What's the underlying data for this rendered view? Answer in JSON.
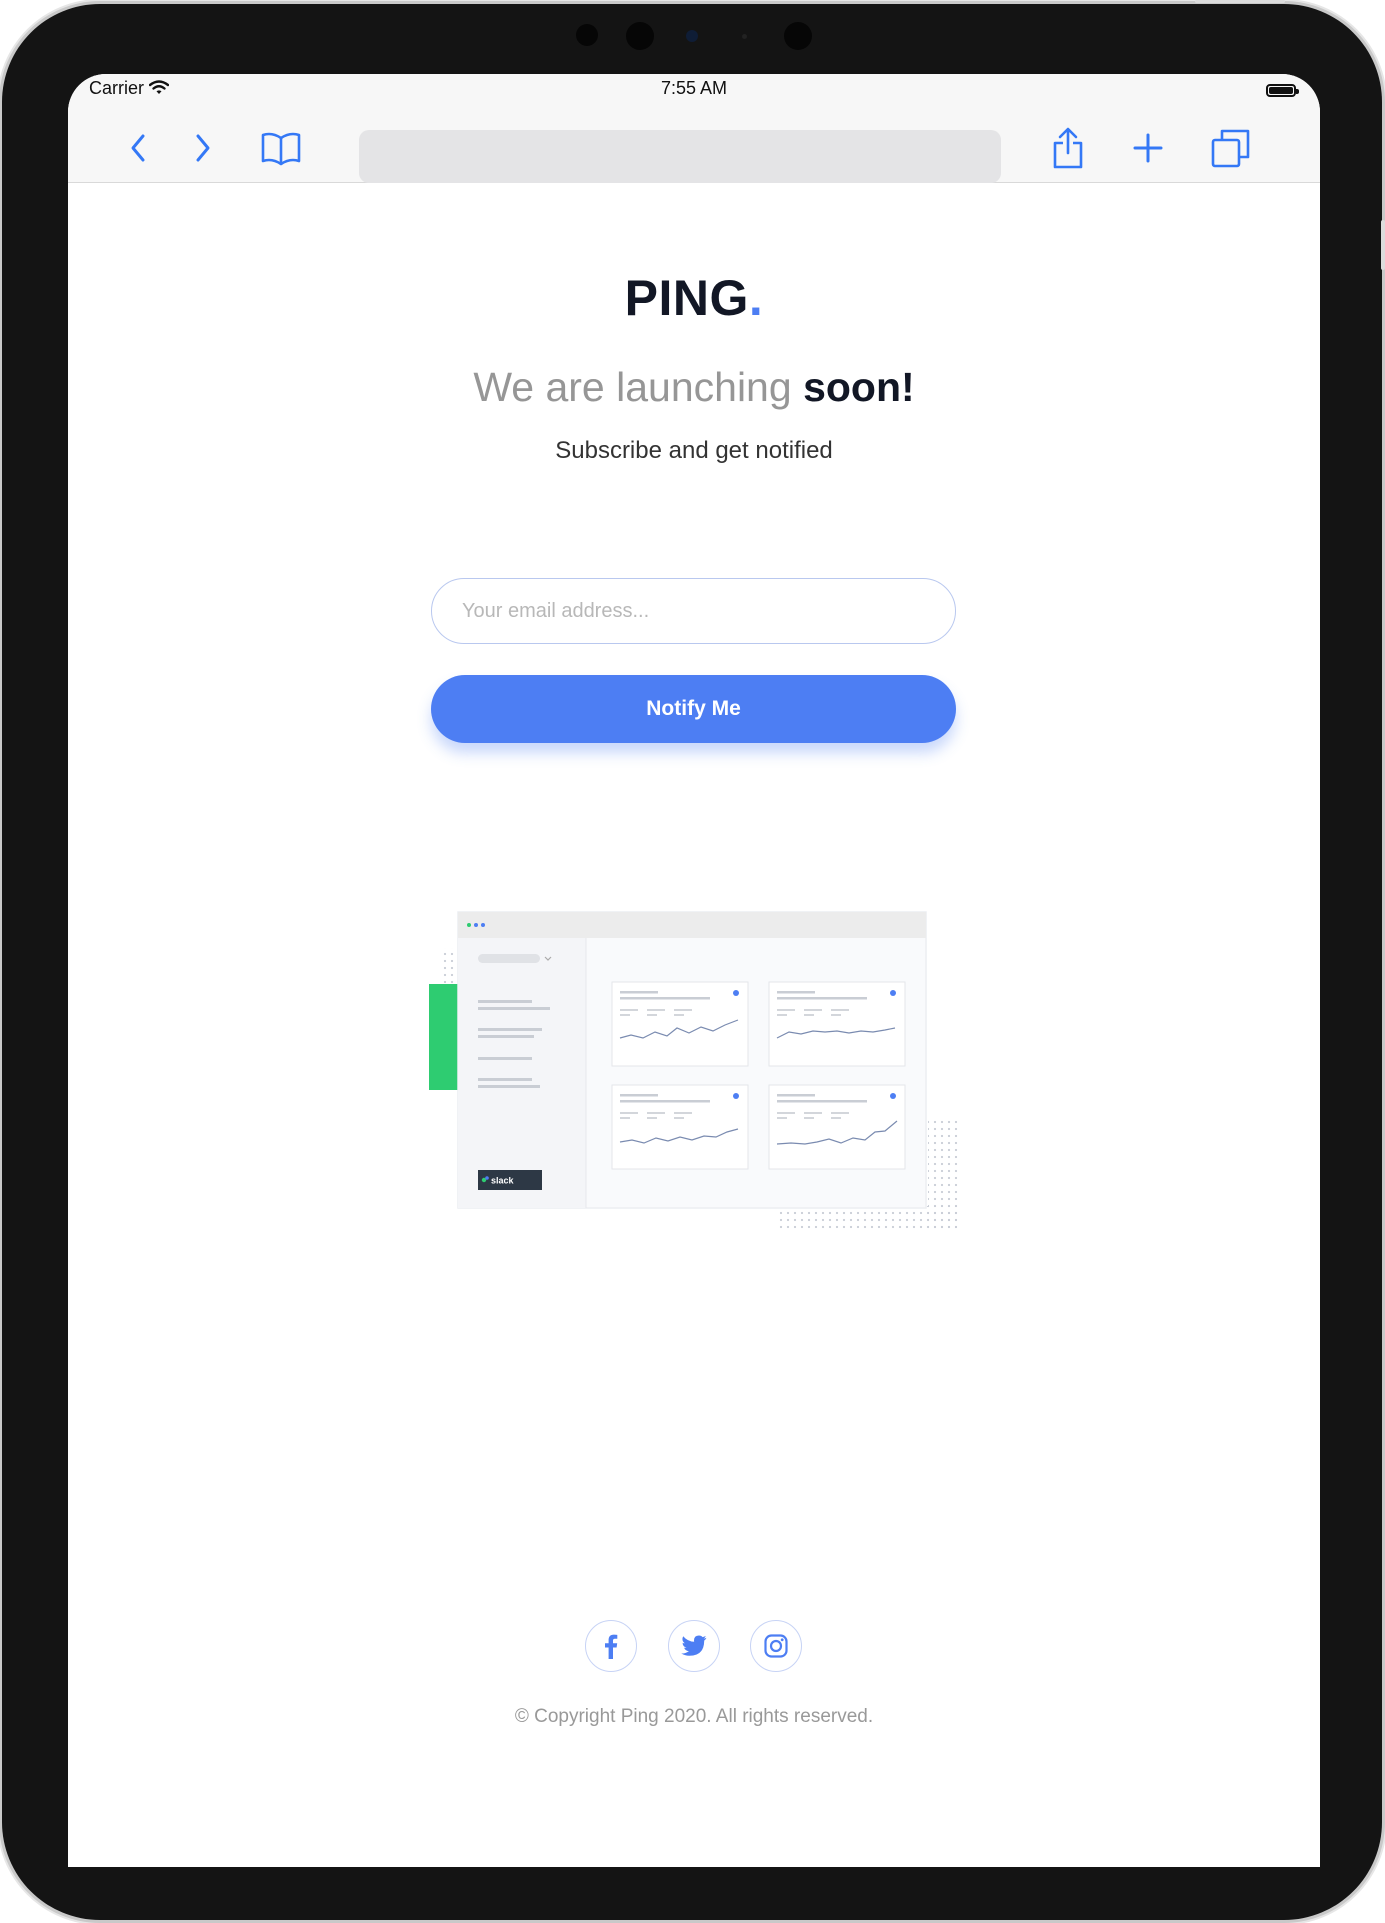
{
  "device": {
    "status_bar": {
      "carrier": "Carrier",
      "time": "7:55 AM",
      "wifi_icon": "wifi-icon",
      "battery_icon": "battery-icon"
    },
    "toolbar": {
      "buttons": [
        "back-chevron-icon",
        "forward-chevron-icon",
        "bookmarks-book-icon",
        "share-icon",
        "new-tab-plus-icon",
        "tabs-icon"
      ],
      "address_bar": ""
    }
  },
  "page": {
    "logo": {
      "text": "PING",
      "dot": "."
    },
    "headline": {
      "light": "We are launching ",
      "bold": "soon!"
    },
    "subheadline": "Subscribe and get notified",
    "email_placeholder": "Your email address...",
    "notify_button": "Notify Me",
    "dashboard_illustration": {
      "badge": "slack"
    },
    "socials": [
      "facebook-icon",
      "twitter-icon",
      "instagram-icon"
    ],
    "copyright": "© Copyright Ping 2020. All rights reserved."
  },
  "colors": {
    "accent": "#4d7ef3",
    "dark": "#121725",
    "muted": "#969696",
    "green": "#2ecc71"
  }
}
